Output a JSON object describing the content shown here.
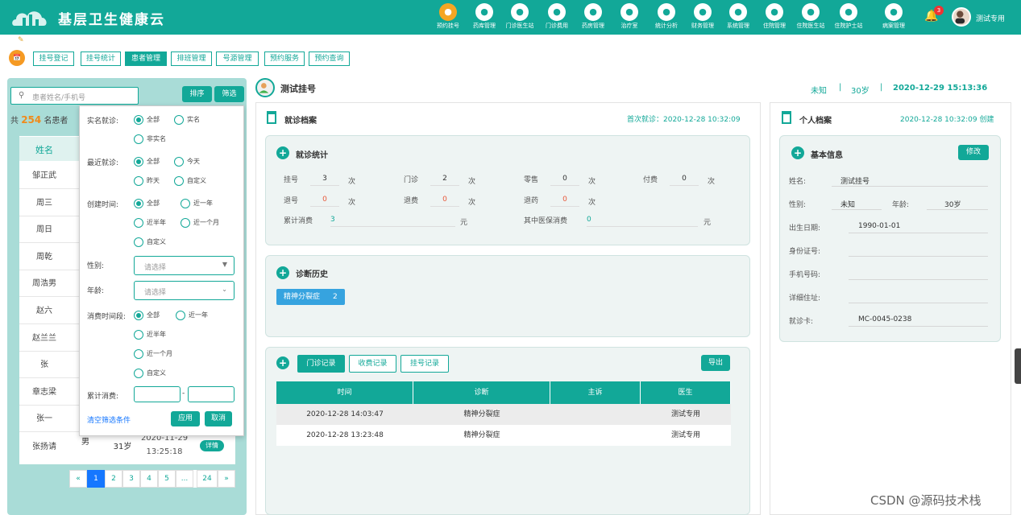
{
  "app": {
    "title": "基层卫生健康云"
  },
  "nav": [
    {
      "label": "预约挂号",
      "icon": "calendar-icon",
      "active": true
    },
    {
      "label": "药库管理",
      "icon": "home-icon"
    },
    {
      "label": "门诊医生站",
      "icon": "doctor-icon"
    },
    {
      "label": "门诊费用",
      "icon": "yen-icon"
    },
    {
      "label": "药房管理",
      "icon": "pill-icon"
    },
    {
      "label": "治疗室",
      "icon": "treatment-icon"
    },
    {
      "label": "统计分析",
      "icon": "chart-icon"
    },
    {
      "label": "财务管理",
      "icon": "gear-icon"
    },
    {
      "label": "系统管理",
      "icon": "settings-icon"
    },
    {
      "label": "住院管理",
      "icon": "bed-icon"
    },
    {
      "label": "住院医生站",
      "icon": "doctor-icon"
    },
    {
      "label": "住院护士站",
      "icon": "nurse-icon"
    },
    {
      "label": "病案管理",
      "icon": "file-icon"
    }
  ],
  "header": {
    "notifications": "3",
    "user": "测试专用"
  },
  "tabs": [
    {
      "label": "挂号登记"
    },
    {
      "label": "挂号统计"
    },
    {
      "label": "患者管理",
      "active": true
    },
    {
      "label": "排班管理"
    },
    {
      "label": "号源管理"
    },
    {
      "label": "预约服务"
    },
    {
      "label": "预约查询"
    }
  ],
  "left": {
    "search_placeholder": "患者姓名/手机号",
    "sort": "排序",
    "filter": "筛选",
    "count_prefix": "共",
    "count": "254",
    "count_suffix": "名患者",
    "col_name": "姓名",
    "names": [
      "邹正武",
      "周三",
      "周日",
      "周乾",
      "周浩男",
      "赵六",
      "赵兰兰",
      "张",
      "章志梁",
      "张一"
    ],
    "last": {
      "name": "张扬请",
      "gender": "男",
      "age": "31岁",
      "date": "2020-11-29",
      "time": "13:25:18",
      "btn": "详情"
    },
    "pages": [
      "«",
      "1",
      "2",
      "3",
      "4",
      "5",
      "...",
      "24",
      "»"
    ]
  },
  "filter": {
    "real_label": "实名就诊:",
    "real_opts": [
      "全部",
      "实名",
      "非实名"
    ],
    "recent_label": "最近就诊:",
    "recent_opts": [
      "全部",
      "今天",
      "昨天",
      "自定义"
    ],
    "create_label": "创建时间:",
    "create_opts": [
      "全部",
      "近一年",
      "近半年",
      "近一个月",
      "自定义"
    ],
    "gender_label": "性别:",
    "gender_ph": "请选择",
    "age_label": "年龄:",
    "age_ph": "请选择",
    "spend_label": "消费时间段:",
    "spend_opts": [
      "全部",
      "近一年",
      "近半年",
      "近一个月",
      "自定义"
    ],
    "total_label": "累计消费:",
    "dash": "-",
    "clear": "清空筛选条件",
    "apply": "应用",
    "cancel": "取消"
  },
  "patient": {
    "name": "测试挂号",
    "gender": "未知",
    "sep1": "|",
    "age": "30岁",
    "sep2": "|",
    "time": "2020-12-29 15:13:36"
  },
  "visit": {
    "title": "就诊档案",
    "first_label": "首次就诊：2020-12-28 10:32:09",
    "stats_title": "就诊统计",
    "stats": [
      {
        "label": "挂号",
        "value": "3",
        "unit": "次"
      },
      {
        "label": "门诊",
        "value": "2",
        "unit": "次"
      },
      {
        "label": "零售",
        "value": "0",
        "unit": "次"
      },
      {
        "label": "付费",
        "value": "0",
        "unit": "次"
      },
      {
        "label": "退号",
        "value": "0",
        "unit": "次"
      },
      {
        "label": "退费",
        "value": "0",
        "unit": "次"
      },
      {
        "label": "退药",
        "value": "0",
        "unit": "次"
      }
    ],
    "total_label": "累计消费",
    "total": "3",
    "total_unit": "元",
    "insurance_label": "其中医保消费",
    "insurance": "0",
    "insurance_unit": "元",
    "diag_title": "诊断历史",
    "diag_tag": "精神分裂症",
    "diag_count": "2",
    "rec_tabs": [
      "门诊记录",
      "收费记录",
      "挂号记录"
    ],
    "export": "导出",
    "cols": [
      "时间",
      "诊断",
      "主诉",
      "医生"
    ],
    "rows": [
      [
        "2020-12-28 14:03:47",
        "精神分裂症",
        "",
        "测试专用"
      ],
      [
        "2020-12-28 13:23:48",
        "精神分裂症",
        "",
        "测试专用"
      ]
    ]
  },
  "profile": {
    "title": "个人档案",
    "created": "2020-12-28 10:32:09 创建",
    "basic_title": "基本信息",
    "edit": "修改",
    "name_label": "姓名:",
    "name": "测试挂号",
    "gender_label": "性别:",
    "gender": "未知",
    "age_label": "年龄:",
    "age": "30岁",
    "birth_label": "出生日期:",
    "birth": "1990-01-01",
    "id_label": "身份证号:",
    "id": "",
    "phone_label": "手机号码:",
    "phone": "",
    "addr_label": "详细住址:",
    "addr": "",
    "card_label": "就诊卡:",
    "card": "MC-0045-0238"
  },
  "watermark": "CSDN @源码技术栈"
}
